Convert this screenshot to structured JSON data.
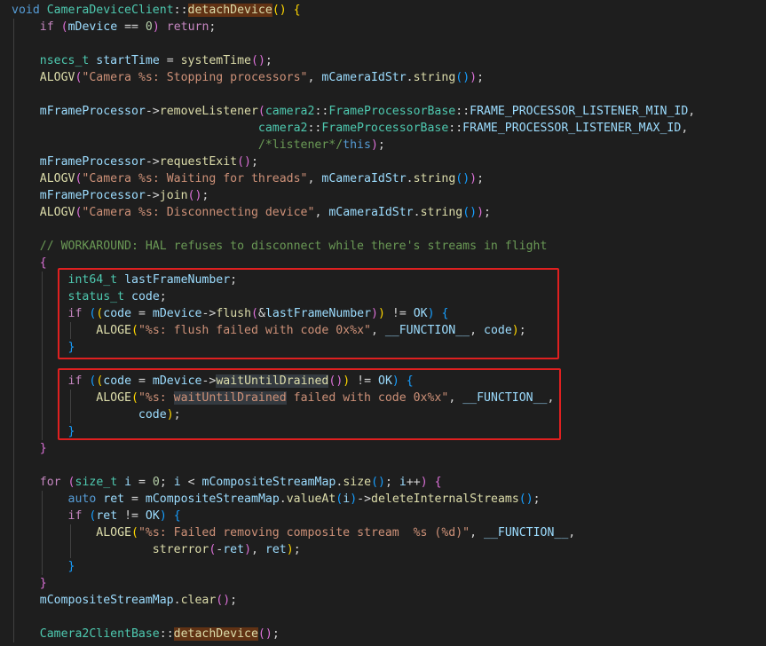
{
  "code": {
    "lines": [
      {
        "n": 1,
        "ind": 0,
        "toks": [
          [
            "kw",
            "void"
          ],
          [
            "op",
            " "
          ],
          [
            "type",
            "CameraDeviceClient"
          ],
          [
            "op",
            "::"
          ],
          [
            "fn hl1",
            "detachDevice"
          ],
          [
            "b1",
            "()"
          ],
          [
            "op",
            " "
          ],
          [
            "b1",
            "{"
          ]
        ]
      },
      {
        "n": 2,
        "ind": 1,
        "toks": [
          [
            "ctl",
            "if"
          ],
          [
            "op",
            " "
          ],
          [
            "b2",
            "("
          ],
          [
            "var",
            "mDevice"
          ],
          [
            "op",
            " == "
          ],
          [
            "num",
            "0"
          ],
          [
            "b2",
            ")"
          ],
          [
            "op",
            " "
          ],
          [
            "ctl",
            "return"
          ],
          [
            "op",
            ";"
          ]
        ]
      },
      {
        "n": 4,
        "ind": 1,
        "toks": [
          [
            "type",
            "nsecs_t"
          ],
          [
            "op",
            " "
          ],
          [
            "var",
            "startTime"
          ],
          [
            "op",
            " = "
          ],
          [
            "fn",
            "systemTime"
          ],
          [
            "b2",
            "()"
          ],
          [
            "op",
            ";"
          ]
        ]
      },
      {
        "n": 5,
        "ind": 1,
        "toks": [
          [
            "fn",
            "ALOGV"
          ],
          [
            "b2",
            "("
          ],
          [
            "str",
            "\"Camera %s: Stopping processors\""
          ],
          [
            "op",
            ", "
          ],
          [
            "var",
            "mCameraIdStr"
          ],
          [
            "op",
            "."
          ],
          [
            "fn",
            "string"
          ],
          [
            "b3",
            "()"
          ],
          [
            "b2",
            ")"
          ],
          [
            "op",
            ";"
          ]
        ]
      },
      {
        "n": 7,
        "ind": 1,
        "toks": [
          [
            "var",
            "mFrameProcessor"
          ],
          [
            "op",
            "->"
          ],
          [
            "fn",
            "removeListener"
          ],
          [
            "b2",
            "("
          ],
          [
            "type",
            "camera2"
          ],
          [
            "op",
            "::"
          ],
          [
            "type",
            "FrameProcessorBase"
          ],
          [
            "op",
            "::"
          ],
          [
            "var",
            "FRAME_PROCESSOR_LISTENER_MIN_ID"
          ],
          [
            "op",
            ","
          ]
        ]
      },
      {
        "n": 8,
        "ind": 1,
        "pad": "                               ",
        "toks": [
          [
            "type",
            "camera2"
          ],
          [
            "op",
            "::"
          ],
          [
            "type",
            "FrameProcessorBase"
          ],
          [
            "op",
            "::"
          ],
          [
            "var",
            "FRAME_PROCESSOR_LISTENER_MAX_ID"
          ],
          [
            "op",
            ","
          ]
        ]
      },
      {
        "n": 9,
        "ind": 1,
        "pad": "                               ",
        "toks": [
          [
            "cmt",
            "/*listener*/"
          ],
          [
            "kw",
            "this"
          ],
          [
            "b2",
            ")"
          ],
          [
            "op",
            ";"
          ]
        ]
      },
      {
        "n": 10,
        "ind": 1,
        "toks": [
          [
            "var",
            "mFrameProcessor"
          ],
          [
            "op",
            "->"
          ],
          [
            "fn",
            "requestExit"
          ],
          [
            "b2",
            "()"
          ],
          [
            "op",
            ";"
          ]
        ]
      },
      {
        "n": 11,
        "ind": 1,
        "toks": [
          [
            "fn",
            "ALOGV"
          ],
          [
            "b2",
            "("
          ],
          [
            "str",
            "\"Camera %s: Waiting for threads\""
          ],
          [
            "op",
            ", "
          ],
          [
            "var",
            "mCameraIdStr"
          ],
          [
            "op",
            "."
          ],
          [
            "fn",
            "string"
          ],
          [
            "b3",
            "()"
          ],
          [
            "b2",
            ")"
          ],
          [
            "op",
            ";"
          ]
        ]
      },
      {
        "n": 12,
        "ind": 1,
        "toks": [
          [
            "var",
            "mFrameProcessor"
          ],
          [
            "op",
            "->"
          ],
          [
            "fn",
            "join"
          ],
          [
            "b2",
            "()"
          ],
          [
            "op",
            ";"
          ]
        ]
      },
      {
        "n": 13,
        "ind": 1,
        "toks": [
          [
            "fn",
            "ALOGV"
          ],
          [
            "b2",
            "("
          ],
          [
            "str",
            "\"Camera %s: Disconnecting device\""
          ],
          [
            "op",
            ", "
          ],
          [
            "var",
            "mCameraIdStr"
          ],
          [
            "op",
            "."
          ],
          [
            "fn",
            "string"
          ],
          [
            "b3",
            "()"
          ],
          [
            "b2",
            ")"
          ],
          [
            "op",
            ";"
          ]
        ]
      },
      {
        "n": 15,
        "ind": 1,
        "toks": [
          [
            "cmt",
            "// WORKAROUND: HAL refuses to disconnect while there's streams in flight"
          ]
        ]
      },
      {
        "n": 16,
        "ind": 1,
        "toks": [
          [
            "b2",
            "{"
          ]
        ]
      },
      {
        "n": 17,
        "ind": 2,
        "toks": [
          [
            "type",
            "int64_t"
          ],
          [
            "op",
            " "
          ],
          [
            "var",
            "lastFrameNumber"
          ],
          [
            "op",
            ";"
          ]
        ]
      },
      {
        "n": 18,
        "ind": 2,
        "toks": [
          [
            "type",
            "status_t"
          ],
          [
            "op",
            " "
          ],
          [
            "var",
            "code"
          ],
          [
            "op",
            ";"
          ]
        ]
      },
      {
        "n": 19,
        "ind": 2,
        "toks": [
          [
            "ctl",
            "if"
          ],
          [
            "op",
            " "
          ],
          [
            "b3",
            "("
          ],
          [
            "b1",
            "("
          ],
          [
            "var",
            "code"
          ],
          [
            "op",
            " = "
          ],
          [
            "var",
            "mDevice"
          ],
          [
            "op",
            "->"
          ],
          [
            "fn",
            "flush"
          ],
          [
            "b2",
            "("
          ],
          [
            "op",
            "&"
          ],
          [
            "var",
            "lastFrameNumber"
          ],
          [
            "b2",
            ")"
          ],
          [
            "b1",
            ")"
          ],
          [
            "op",
            " != "
          ],
          [
            "var",
            "OK"
          ],
          [
            "b3",
            ")"
          ],
          [
            "op",
            " "
          ],
          [
            "b3",
            "{"
          ]
        ]
      },
      {
        "n": 20,
        "ind": 3,
        "toks": [
          [
            "fn",
            "ALOGE"
          ],
          [
            "b1",
            "("
          ],
          [
            "str",
            "\"%s: flush failed with code 0x%x\""
          ],
          [
            "op",
            ", "
          ],
          [
            "var",
            "__FUNCTION__"
          ],
          [
            "op",
            ", "
          ],
          [
            "var",
            "code"
          ],
          [
            "b1",
            ")"
          ],
          [
            "op",
            ";"
          ]
        ]
      },
      {
        "n": 21,
        "ind": 2,
        "toks": [
          [
            "b3",
            "}"
          ]
        ]
      },
      {
        "n": 23,
        "ind": 2,
        "toks": [
          [
            "ctl",
            "if"
          ],
          [
            "op",
            " "
          ],
          [
            "b3",
            "("
          ],
          [
            "b1",
            "("
          ],
          [
            "var",
            "code"
          ],
          [
            "op",
            " = "
          ],
          [
            "var",
            "mDevice"
          ],
          [
            "op",
            "->"
          ],
          [
            "fn hl2",
            "waitUntilDrained"
          ],
          [
            "b2",
            "()"
          ],
          [
            "b1",
            ")"
          ],
          [
            "op",
            " != "
          ],
          [
            "var",
            "OK"
          ],
          [
            "b3",
            ")"
          ],
          [
            "op",
            " "
          ],
          [
            "b3",
            "{"
          ]
        ]
      },
      {
        "n": 24,
        "ind": 3,
        "toks": [
          [
            "fn",
            "ALOGE"
          ],
          [
            "b1",
            "("
          ],
          [
            "str",
            "\"%s: "
          ],
          [
            "str hl2",
            "waitUntilDrained"
          ],
          [
            "str",
            " failed with code 0x%x\""
          ],
          [
            "op",
            ", "
          ],
          [
            "var",
            "__FUNCTION__"
          ],
          [
            "op",
            ","
          ]
        ]
      },
      {
        "n": 25,
        "ind": 3,
        "pad": "      ",
        "toks": [
          [
            "var",
            "code"
          ],
          [
            "b1",
            ")"
          ],
          [
            "op",
            ";"
          ]
        ]
      },
      {
        "n": 26,
        "ind": 2,
        "toks": [
          [
            "b3",
            "}"
          ]
        ]
      },
      {
        "n": 27,
        "ind": 1,
        "toks": [
          [
            "b2",
            "}"
          ]
        ]
      },
      {
        "n": 29,
        "ind": 1,
        "toks": [
          [
            "ctl",
            "for"
          ],
          [
            "op",
            " "
          ],
          [
            "b2",
            "("
          ],
          [
            "type",
            "size_t"
          ],
          [
            "op",
            " "
          ],
          [
            "var",
            "i"
          ],
          [
            "op",
            " = "
          ],
          [
            "num",
            "0"
          ],
          [
            "op",
            "; "
          ],
          [
            "var",
            "i"
          ],
          [
            "op",
            " < "
          ],
          [
            "var",
            "mCompositeStreamMap"
          ],
          [
            "op",
            "."
          ],
          [
            "fn",
            "size"
          ],
          [
            "b3",
            "()"
          ],
          [
            "op",
            "; "
          ],
          [
            "var",
            "i"
          ],
          [
            "op",
            "++"
          ],
          [
            "b2",
            ")"
          ],
          [
            "op",
            " "
          ],
          [
            "b2",
            "{"
          ]
        ]
      },
      {
        "n": 30,
        "ind": 2,
        "toks": [
          [
            "kw",
            "auto"
          ],
          [
            "op",
            " "
          ],
          [
            "var",
            "ret"
          ],
          [
            "op",
            " = "
          ],
          [
            "var",
            "mCompositeStreamMap"
          ],
          [
            "op",
            "."
          ],
          [
            "fn",
            "valueAt"
          ],
          [
            "b3",
            "("
          ],
          [
            "var",
            "i"
          ],
          [
            "b3",
            ")"
          ],
          [
            "op",
            "->"
          ],
          [
            "fn",
            "deleteInternalStreams"
          ],
          [
            "b3",
            "()"
          ],
          [
            "op",
            ";"
          ]
        ]
      },
      {
        "n": 31,
        "ind": 2,
        "toks": [
          [
            "ctl",
            "if"
          ],
          [
            "op",
            " "
          ],
          [
            "b3",
            "("
          ],
          [
            "var",
            "ret"
          ],
          [
            "op",
            " != "
          ],
          [
            "var",
            "OK"
          ],
          [
            "b3",
            ")"
          ],
          [
            "op",
            " "
          ],
          [
            "b3",
            "{"
          ]
        ]
      },
      {
        "n": 32,
        "ind": 3,
        "toks": [
          [
            "fn",
            "ALOGE"
          ],
          [
            "b1",
            "("
          ],
          [
            "str",
            "\"%s: Failed removing composite stream  %s (%d)\""
          ],
          [
            "op",
            ", "
          ],
          [
            "var",
            "__FUNCTION__"
          ],
          [
            "op",
            ","
          ]
        ]
      },
      {
        "n": 33,
        "ind": 3,
        "pad": "        ",
        "toks": [
          [
            "fn",
            "strerror"
          ],
          [
            "b2",
            "("
          ],
          [
            "op",
            "-"
          ],
          [
            "var",
            "ret"
          ],
          [
            "b2",
            ")"
          ],
          [
            "op",
            ", "
          ],
          [
            "var",
            "ret"
          ],
          [
            "b1",
            ")"
          ],
          [
            "op",
            ";"
          ]
        ]
      },
      {
        "n": 34,
        "ind": 2,
        "toks": [
          [
            "b3",
            "}"
          ]
        ]
      },
      {
        "n": 35,
        "ind": 1,
        "toks": [
          [
            "b2",
            "}"
          ]
        ]
      },
      {
        "n": 36,
        "ind": 1,
        "toks": [
          [
            "var",
            "mCompositeStreamMap"
          ],
          [
            "op",
            "."
          ],
          [
            "fn",
            "clear"
          ],
          [
            "b2",
            "()"
          ],
          [
            "op",
            ";"
          ]
        ]
      },
      {
        "n": 38,
        "ind": 1,
        "toks": [
          [
            "type",
            "Camera2ClientBase"
          ],
          [
            "op",
            "::"
          ],
          [
            "fn hl1",
            "detachDevice"
          ],
          [
            "b2",
            "()"
          ],
          [
            "op",
            ";"
          ]
        ]
      }
    ]
  },
  "theme": {
    "background": "#1e1e1e",
    "highlight_box": "#e02020"
  }
}
